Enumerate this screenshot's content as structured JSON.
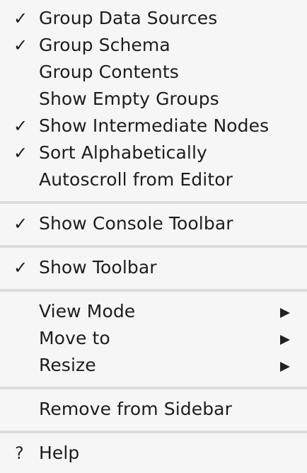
{
  "menu": {
    "check_glyph": "✓",
    "help_glyph": "?",
    "items": [
      {
        "label": "Group Data Sources",
        "checked": true
      },
      {
        "label": "Group Schema",
        "checked": true
      },
      {
        "label": "Group Contents",
        "checked": false
      },
      {
        "label": "Show Empty Groups",
        "checked": false
      },
      {
        "label": "Show Intermediate Nodes",
        "checked": true
      },
      {
        "label": "Sort Alphabetically",
        "checked": true
      },
      {
        "label": "Autoscroll from Editor",
        "checked": false
      },
      {
        "label": "Show Console Toolbar",
        "checked": true
      },
      {
        "label": "Show Toolbar",
        "checked": true
      },
      {
        "label": "View Mode",
        "checked": false,
        "submenu": true
      },
      {
        "label": "Move to",
        "checked": false,
        "submenu": true
      },
      {
        "label": "Resize",
        "checked": false,
        "submenu": true
      },
      {
        "label": "Remove from Sidebar",
        "checked": false
      },
      {
        "label": "Help",
        "checked": false
      }
    ]
  }
}
